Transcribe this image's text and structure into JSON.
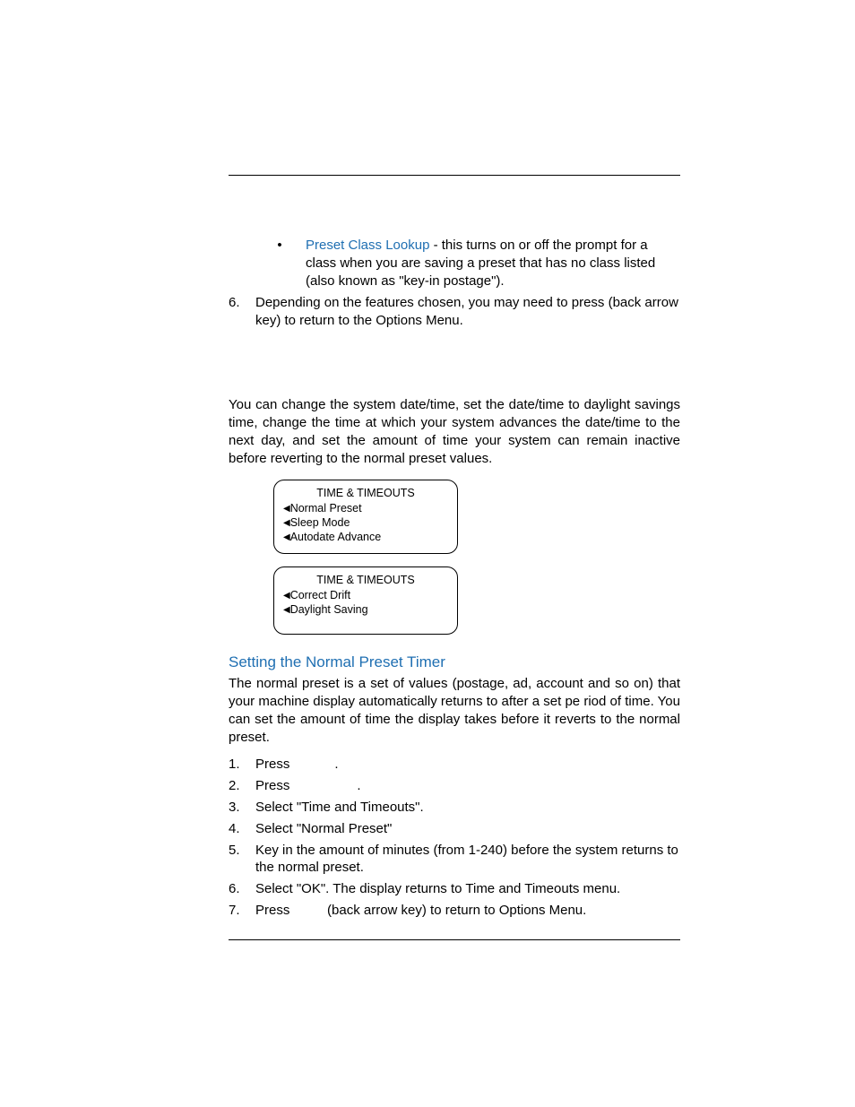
{
  "bullet1_link": "Preset Class Lookup",
  "bullet1_rest": " - this turns on or off the prompt for a class when you are saving a preset that has no class listed (also known as \"key-in postage\").",
  "top_step6_num": "6.",
  "top_step6_text": "Depending on the features chosen, you may need to press (back arrow key) to return to the Options Menu.",
  "intro_para": "You can change the system date/time, set the date/time to daylight savings time, change the time at which your system advances the date/time to the next day, and set the amount of time your system can remain inactive before reverting to the normal preset values.",
  "screen1": {
    "title": "TIME & TIMEOUTS",
    "items": [
      "Normal Preset",
      "Sleep Mode",
      "Autodate Advance"
    ]
  },
  "screen2": {
    "title": "TIME & TIMEOUTS",
    "items": [
      "Correct Drift",
      "Daylight Saving"
    ]
  },
  "heading": "Setting the Normal Preset Timer",
  "body_para": "The normal preset is a set of values (postage, ad, account and so on) that your machine display automatically returns to after a set pe riod of time. You can set the amount of time the display takes before it reverts to the normal preset.",
  "steps": [
    {
      "n": "1.",
      "t": "Press            ."
    },
    {
      "n": "2.",
      "t": "Press                  ."
    },
    {
      "n": "3.",
      "t": "Select \"Time and Timeouts\"."
    },
    {
      "n": "4.",
      "t": "Select \"Normal Preset\""
    },
    {
      "n": "5.",
      "t": "Key in the amount of minutes (from 1-240) before the system returns to the normal preset."
    },
    {
      "n": "6.",
      "t": "Select \"OK\". The display returns to Time and Timeouts menu."
    },
    {
      "n": "7.",
      "t": "Press          (back arrow key) to return to Options Menu."
    }
  ]
}
